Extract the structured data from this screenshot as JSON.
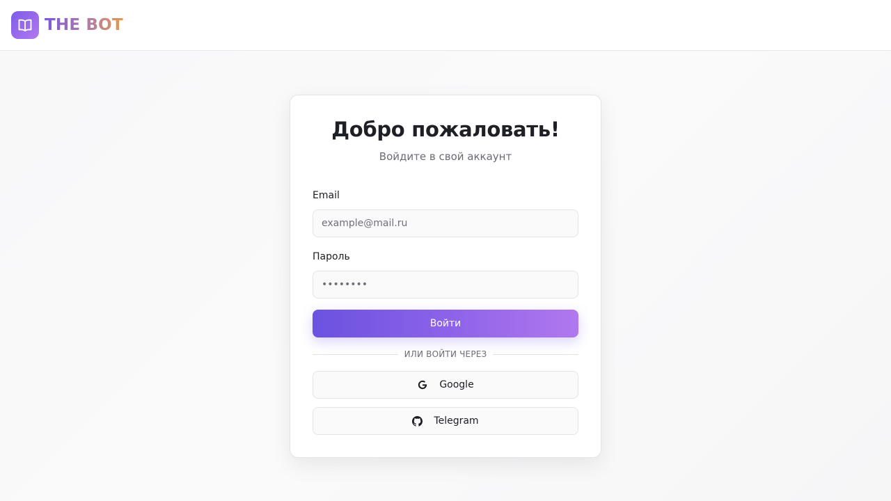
{
  "header": {
    "logo_icon": "book-open-icon",
    "brand": "THE BOT",
    "brand_gradient": [
      "#7a5ad8",
      "#e49a4c"
    ]
  },
  "login": {
    "title": "Добро пожаловать!",
    "subtitle": "Войдите в свой аккаунт",
    "email": {
      "label": "Email",
      "placeholder": "example@mail.ru",
      "value": ""
    },
    "password": {
      "label": "Пароль",
      "placeholder": "••••••••",
      "value": ""
    },
    "submit_label": "Войти",
    "submit_gradient": [
      "#6b52e0",
      "#b178ef"
    ],
    "divider_text": "ИЛИ ВОЙТИ ЧЕРЕЗ",
    "social": [
      {
        "label": "Google",
        "icon": "google-icon"
      },
      {
        "label": "Telegram",
        "icon": "github-icon"
      }
    ]
  }
}
